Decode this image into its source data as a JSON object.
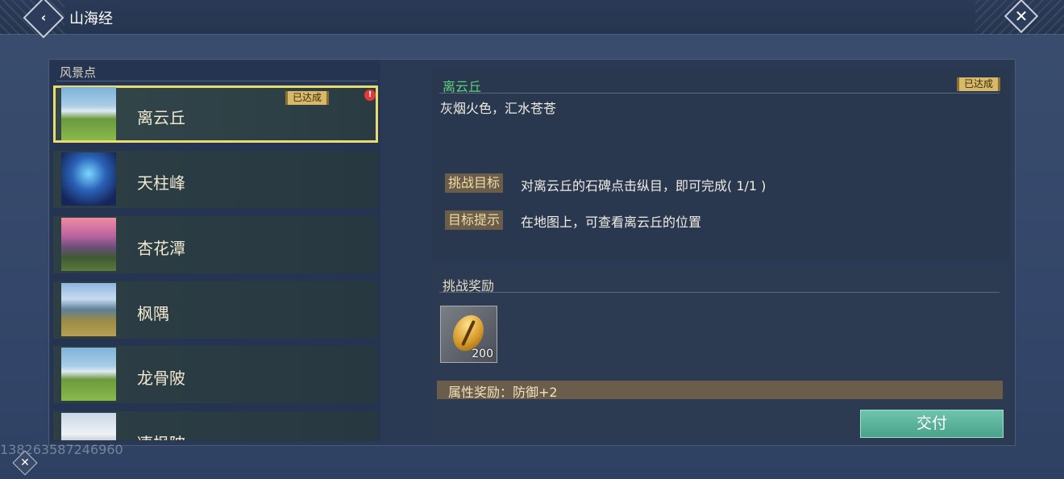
{
  "header": {
    "title": "山海经",
    "back_icon": "back-arrow-icon",
    "close_icon": "close-icon"
  },
  "list": {
    "header": "风景点",
    "items": [
      {
        "name": "离云丘",
        "badge": "已达成",
        "alert": "!",
        "thumb_icon": "snowy-mountain-meadow-thumbnail"
      },
      {
        "name": "天柱峰",
        "thumb_icon": "glowing-blue-peak-thumbnail"
      },
      {
        "name": "杏花潭",
        "thumb_icon": "pink-sunset-lake-thumbnail"
      },
      {
        "name": "枫隅",
        "thumb_icon": "mountain-lake-thumbnail"
      },
      {
        "name": "龙骨陂",
        "thumb_icon": "snowy-mountain-meadow-thumbnail"
      },
      {
        "name": "凄枫陂",
        "thumb_icon": "snowy-peak-thumbnail"
      }
    ]
  },
  "detail": {
    "title": "离云丘",
    "badge": "已达成",
    "description": "灰烟火色，汇水苍苍",
    "goal_label": "挑战目标",
    "goal_text": "对离云丘的石碑点击纵目，即可完成( 1/1 )",
    "hint_label": "目标提示",
    "hint_text": "在地图上，可查看离云丘的位置"
  },
  "reward": {
    "title": "挑战奖励",
    "item_icon": "gold-shell-coin-icon",
    "item_count": "200",
    "attribute": "属性奖励：防御+2",
    "submit_label": "交付"
  },
  "footer": {
    "watermark": "13826358724696​0",
    "mini_close_icon": "close-icon"
  },
  "colors": {
    "selected_border": "#e9dc6e",
    "title_green": "#5fd07c",
    "badge_gold": "#d8b969",
    "submit_teal": "#4aa38a"
  }
}
